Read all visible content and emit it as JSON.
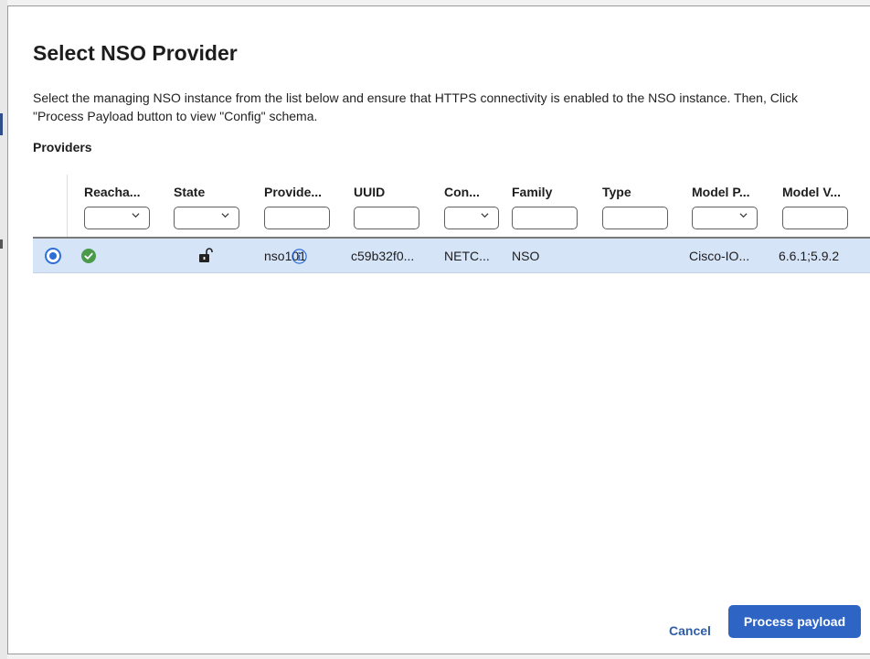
{
  "dialog": {
    "title": "Select NSO Provider",
    "description": "Select the managing NSO instance from the list below and ensure that HTTPS connectivity is enabled to the NSO instance. Then, Click \"Process Payload button to view \"Config\" schema.",
    "section_label": "Providers"
  },
  "table": {
    "columns": [
      {
        "key": "reachability",
        "label": "Reacha...",
        "filter": "select"
      },
      {
        "key": "state",
        "label": "State",
        "filter": "select"
      },
      {
        "key": "provider",
        "label": "Provide...",
        "filter": "text"
      },
      {
        "key": "uuid",
        "label": "UUID",
        "filter": "text"
      },
      {
        "key": "connection",
        "label": "Con...",
        "filter": "select"
      },
      {
        "key": "family",
        "label": "Family",
        "filter": "text"
      },
      {
        "key": "type",
        "label": "Type",
        "filter": "text"
      },
      {
        "key": "model_prefix",
        "label": "Model P...",
        "filter": "select"
      },
      {
        "key": "model_version",
        "label": "Model V...",
        "filter": "text"
      }
    ],
    "rows": [
      {
        "selected": true,
        "reachability_icon": "check-circle-icon",
        "state_icon": "unlock-icon",
        "provider": "nso101",
        "uuid": "c59b32f0...",
        "connection": "NETC...",
        "family": "NSO",
        "type": "",
        "model_prefix": "Cisco-IO...",
        "model_version": "6.6.1;5.9.2"
      }
    ]
  },
  "footer": {
    "cancel_label": "Cancel",
    "primary_label": "Process payload"
  },
  "colors": {
    "accent": "#2e65c4",
    "selected_row": "#d6e4f8",
    "success": "#4a9a4a"
  }
}
